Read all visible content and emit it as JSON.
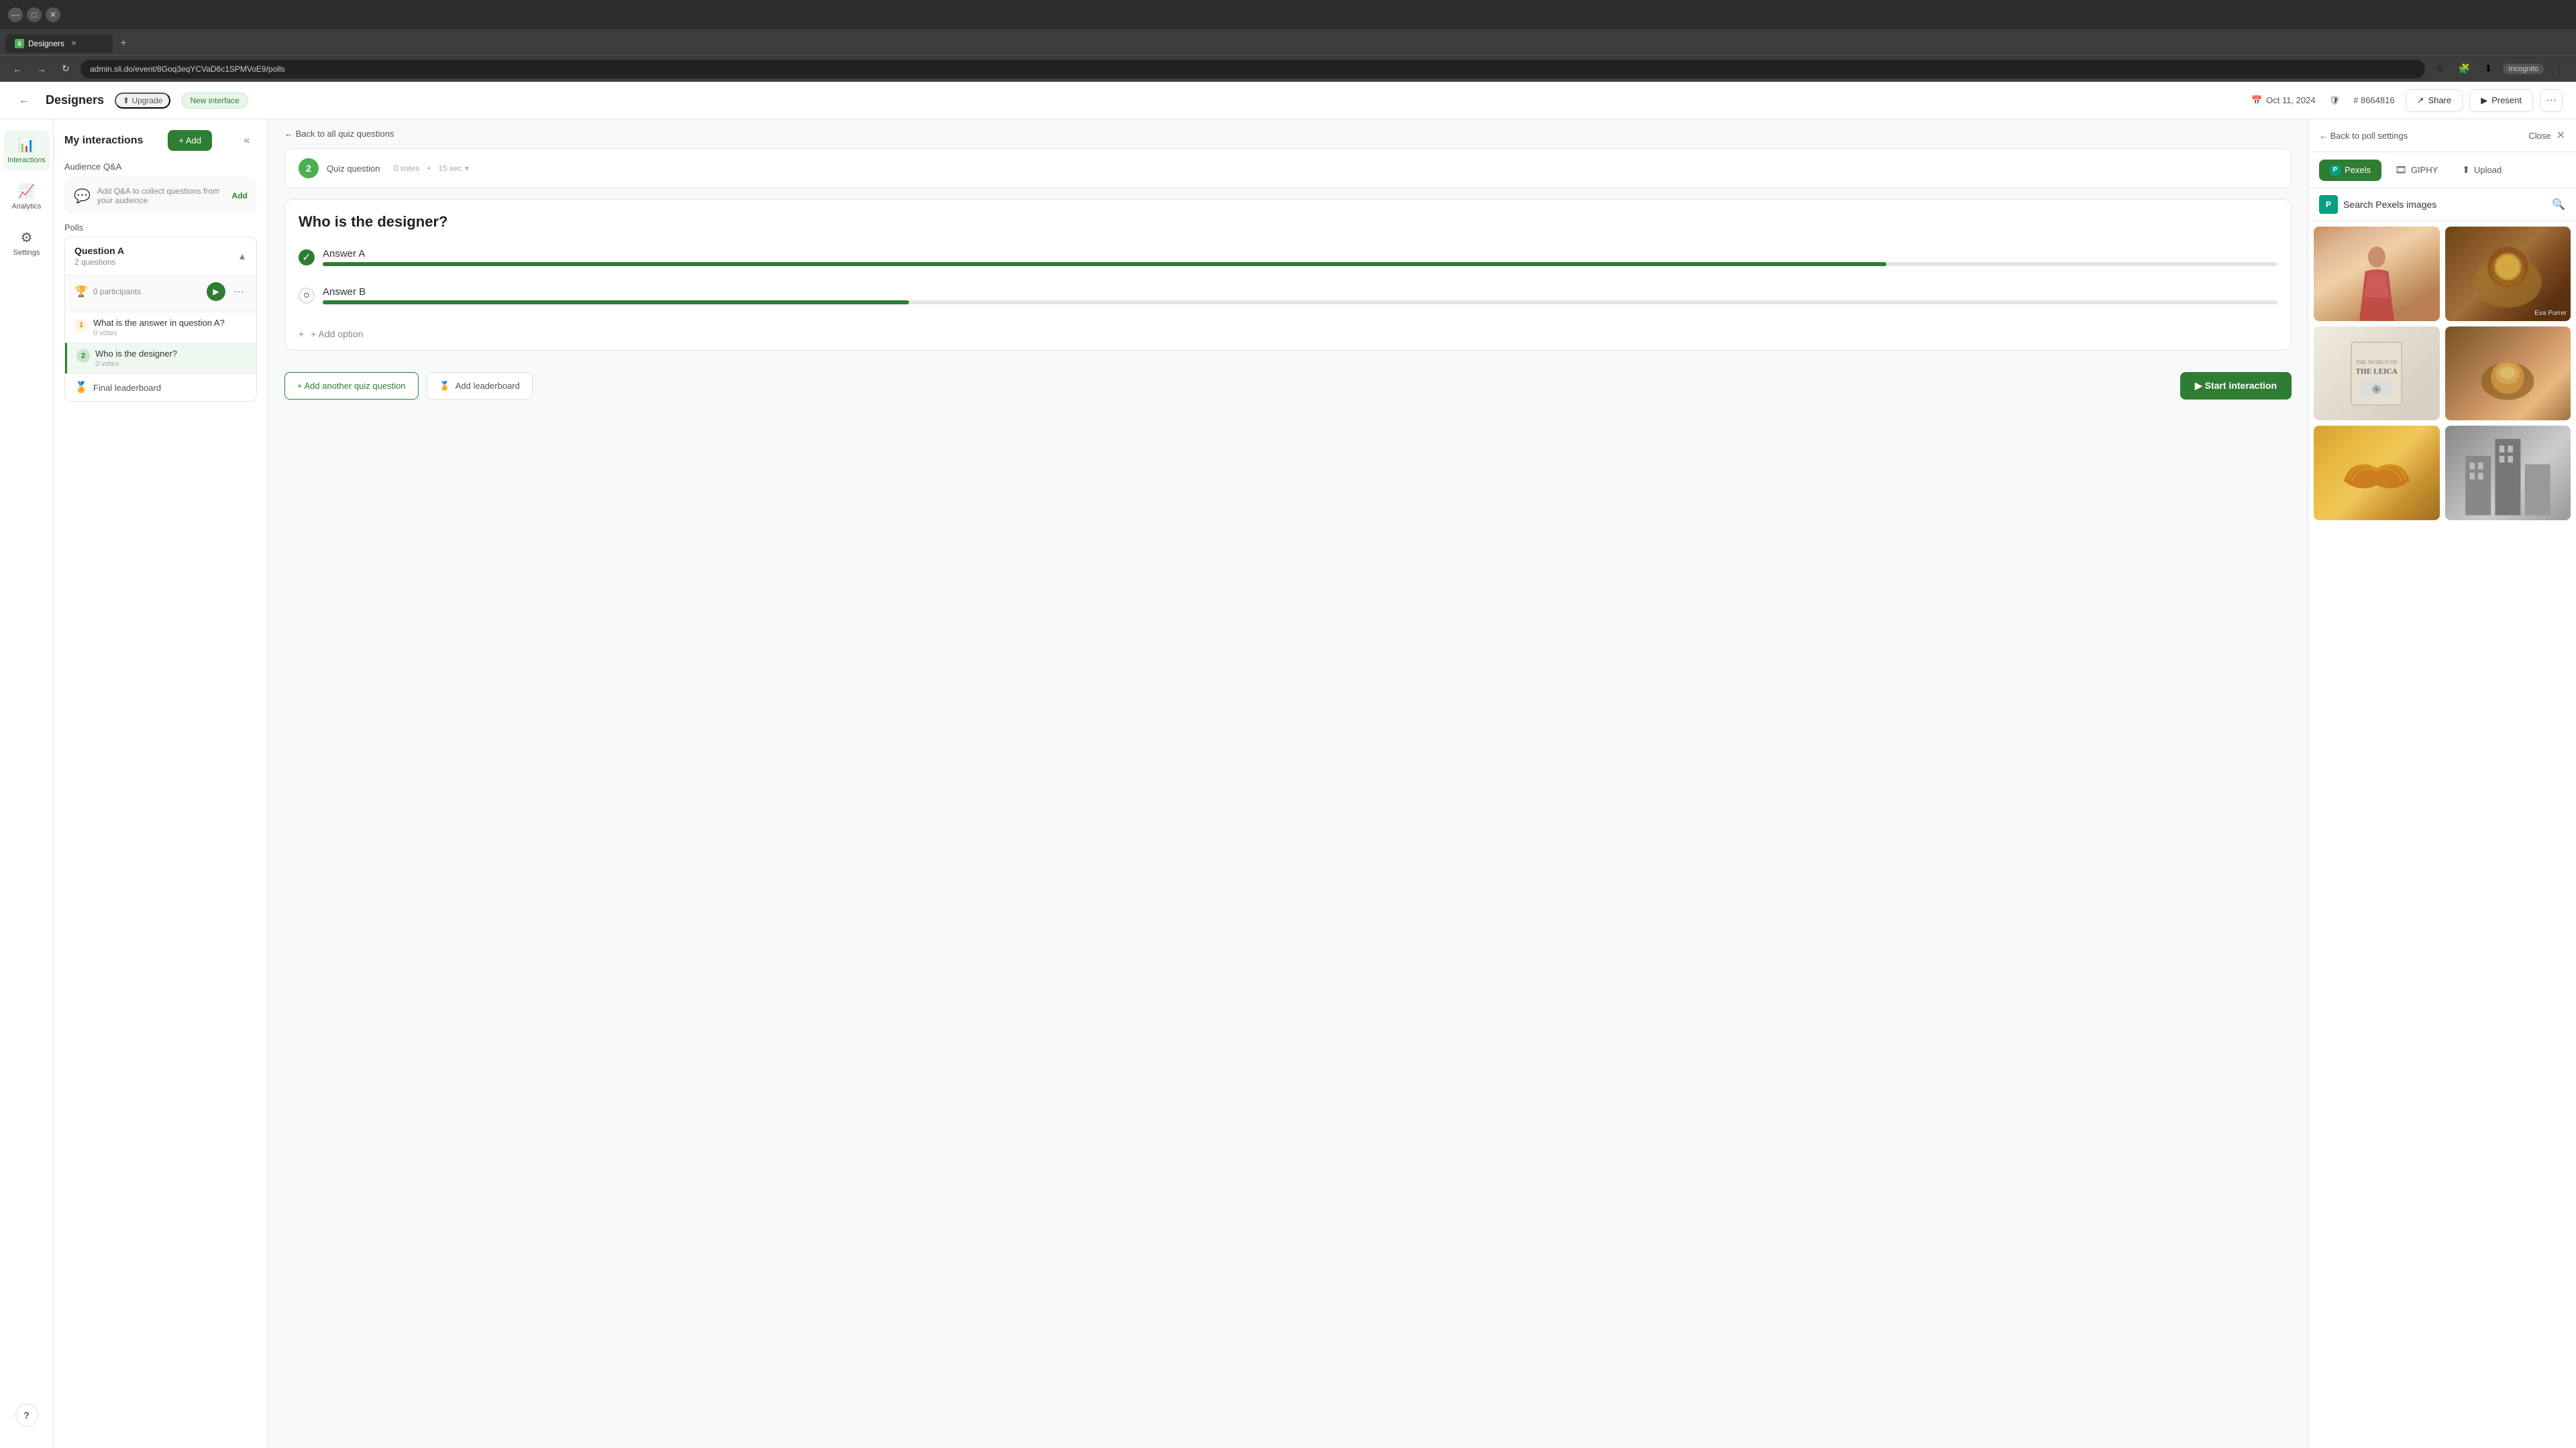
{
  "browser": {
    "url": "admin.sli.do/event/8Goq3eqYCVaD6c1SPMVoE9/polls",
    "tab_label": "Designers",
    "tab_favicon": "S",
    "incognito_label": "Incognito"
  },
  "header": {
    "back_label": "←",
    "title": "Designers",
    "upgrade_label": "Upgrade",
    "new_interface_label": "New interface",
    "date": "Oct 11, 2024",
    "hash_id": "# 8664816",
    "share_label": "Share",
    "present_label": "Present",
    "more_label": "···"
  },
  "sidebar": {
    "interactions_label": "Interactions",
    "analytics_label": "Analytics",
    "settings_label": "Settings",
    "help_label": "?"
  },
  "panel": {
    "title": "My interactions",
    "add_label": "+ Add",
    "collapse_label": "«",
    "audience_qa_label": "Audience Q&A",
    "qa_placeholder": "Add Q&A to collect questions from your audience",
    "qa_add_label": "Add",
    "polls_label": "Polls",
    "question_group": {
      "title": "Question A",
      "count": "2 questions",
      "participants": "0 participants",
      "question1": {
        "number": "1",
        "text": "What is the answer in question A?",
        "votes": "0 votes"
      },
      "question2": {
        "number": "2",
        "text": "Who is the designer?",
        "votes": "0 votes",
        "active": true
      },
      "leaderboard": "Final leaderboard"
    }
  },
  "quiz": {
    "back_label": "← Back to all quiz questions",
    "question_number": "2",
    "type_label": "Quiz question",
    "votes_label": "0 votes",
    "time_label": "15 sec",
    "question_title": "Who is the designer?",
    "answer_a": "Answer A",
    "answer_b": "Answer B",
    "add_option_label": "+ Add option",
    "add_quiz_label": "+ Add another quiz question",
    "add_leaderboard_label": "Add leaderboard",
    "start_label": "▶ Start interaction"
  },
  "pexels": {
    "back_label": "← Back to poll settings",
    "close_label": "Close",
    "close_x": "✕",
    "pexels_tab": "Pexels",
    "giphy_tab": "GIPHY",
    "upload_tab": "Upload",
    "search_label": "Search Pexels images",
    "search_logo": "P",
    "images": [
      {
        "id": "img1",
        "class": "img-woman-traditional",
        "credit": ""
      },
      {
        "id": "img2",
        "class": "img-lion",
        "credit": "Eva Purrer"
      },
      {
        "id": "img3",
        "class": "img-leica",
        "credit": ""
      },
      {
        "id": "img4",
        "class": "img-food",
        "credit": ""
      },
      {
        "id": "img5",
        "class": "img-croissant",
        "credit": ""
      },
      {
        "id": "img6",
        "class": "img-urban",
        "credit": ""
      }
    ]
  }
}
